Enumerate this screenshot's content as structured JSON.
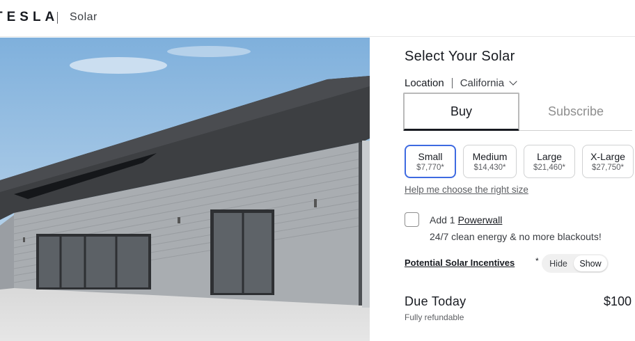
{
  "header": {
    "brand": "TESLA",
    "product": "Solar"
  },
  "panel": {
    "title": "Select Your Solar",
    "location_label": "Location",
    "location_value": "California",
    "tabs": [
      {
        "label": "Buy",
        "selected": true
      },
      {
        "label": "Subscribe",
        "selected": false
      }
    ],
    "sizes": [
      {
        "name": "Small",
        "price": "$7,770*",
        "selected": true
      },
      {
        "name": "Medium",
        "price": "$14,430*",
        "selected": false
      },
      {
        "name": "Large",
        "price": "$21,460*",
        "selected": false
      },
      {
        "name": "X-Large",
        "price": "$27,750*",
        "selected": false
      }
    ],
    "help_link": "Help me choose the right size",
    "powerwall": {
      "add_text": "Add 1",
      "link": "Powerwall",
      "description": "24/7 clean energy & no more blackouts!",
      "checked": false
    },
    "incentives": {
      "label": "Potential Solar Incentives",
      "asterisk": "*",
      "toggle_hide": "Hide",
      "toggle_show": "Show",
      "selected": "Show"
    },
    "due": {
      "label": "Due Today",
      "amount": "$100",
      "note": "Fully refundable"
    }
  },
  "colors": {
    "accent": "#3e6ae1",
    "text": "#171a20"
  }
}
